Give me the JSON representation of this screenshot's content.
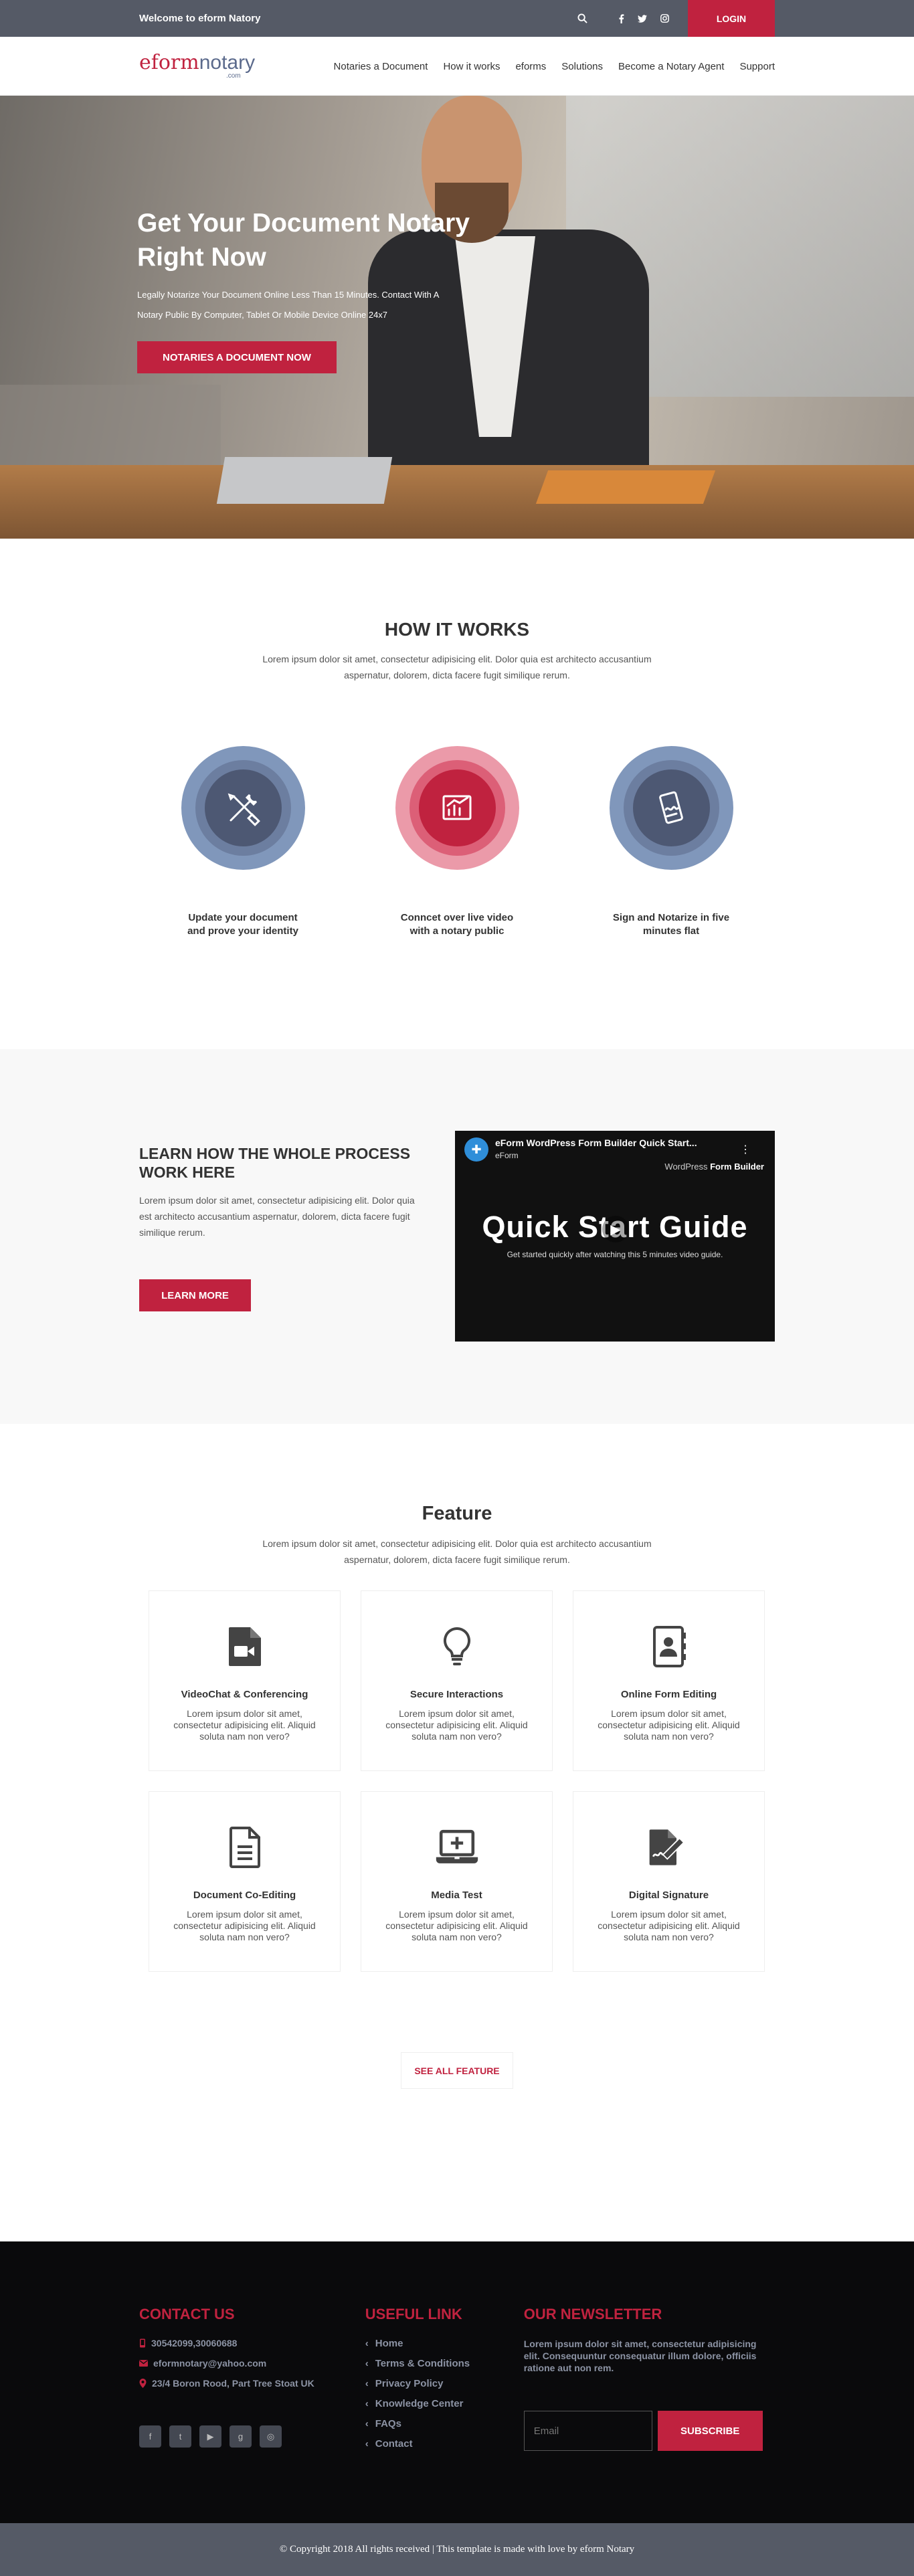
{
  "topbar": {
    "welcome": "Welcome to eform Natory",
    "login_label": "LOGIN",
    "icons": [
      "search-icon",
      "facebook-icon",
      "twitter-icon",
      "instagram-icon"
    ]
  },
  "logo": {
    "part1": "eform",
    "part2": "notary",
    "suffix": ".com"
  },
  "nav": {
    "items": [
      "Notaries a Document",
      "How it works",
      "eforms",
      "Solutions",
      "Become a Notary Agent",
      "Support"
    ]
  },
  "hero": {
    "title": "Get Your Document Notary Right Now",
    "subtitle": "Legally Notarize Your Document Online Less Than 15 Minutes. Contact With A Notary Public By Computer, Tablet Or Mobile Device Online 24x7",
    "button": "NOTARIES A DOCUMENT NOW"
  },
  "how": {
    "title": "HOW IT WORKS",
    "subtitle": "Lorem ipsum dolor sit amet, consectetur adipisicing elit. Dolor quia est architecto accusantium aspernatur, dolorem, dicta facere fugit similique rerum.",
    "steps": [
      {
        "label": "Update your document and prove your identity",
        "icon": "tools-icon",
        "color": "blue"
      },
      {
        "label": "Conncet over live video with a notary public",
        "icon": "video-chart-icon",
        "color": "red"
      },
      {
        "label": "Sign and Notarize in five minutes flat",
        "icon": "mobile-sign-icon",
        "color": "blue"
      }
    ]
  },
  "learn": {
    "title": "LEARN HOW THE WHOLE PROCESS WORK HERE",
    "text": "Lorem ipsum dolor sit amet, consectetur adipisicing elit. Dolor quia est architecto accusantium aspernatur, dolorem, dicta facere fugit similique rerum.",
    "button": "LEARN MORE",
    "video": {
      "title": "eForm WordPress Form Builder Quick Start...",
      "brand": "eForm",
      "right_text_1": "WordPress",
      "right_text_2": "Form Builder",
      "headline": "Quick Start Guide",
      "subline": "Get started quickly after watching this 5 minutes video guide."
    }
  },
  "feature": {
    "title": "Feature",
    "subtitle": "Lorem ipsum dolor sit amet, consectetur adipisicing elit. Dolor quia est architecto accusantium aspernatur, dolorem, dicta facere fugit similique rerum.",
    "cards": [
      {
        "title": "VideoChat & Conferencing",
        "text": "Lorem ipsum dolor sit amet, consectetur adipisicing elit. Aliquid soluta nam non vero?",
        "icon": "file-video-icon"
      },
      {
        "title": "Secure Interactions",
        "text": "Lorem ipsum dolor sit amet, consectetur adipisicing elit. Aliquid soluta nam non vero?",
        "icon": "lightbulb-icon"
      },
      {
        "title": "Online Form Editing",
        "text": "Lorem ipsum dolor sit amet, consectetur adipisicing elit. Aliquid soluta nam non vero?",
        "icon": "address-book-icon"
      },
      {
        "title": "Document Co-Editing",
        "text": "Lorem ipsum dolor sit amet, consectetur adipisicing elit. Aliquid soluta nam non vero?",
        "icon": "document-icon"
      },
      {
        "title": "Media Test",
        "text": "Lorem ipsum dolor sit amet, consectetur adipisicing elit. Aliquid soluta nam non vero?",
        "icon": "laptop-plus-icon"
      },
      {
        "title": "Digital Signature",
        "text": "Lorem ipsum dolor sit amet, consectetur adipisicing elit. Aliquid soluta nam non vero?",
        "icon": "file-signature-icon"
      }
    ],
    "see_all": "SEE ALL FEATURE"
  },
  "footer": {
    "contact": {
      "title": "CONTACT US",
      "phone": "30542099,30060688",
      "email": "eformnotary@yahoo.com",
      "address": "23/4 Boron Rood, Part Tree Stoat UK"
    },
    "links": {
      "title": "USEFUL LINK",
      "items": [
        "Home",
        "Terms & Conditions",
        "Privacy Policy",
        "Knowledge Center",
        "FAQs",
        "Contact"
      ]
    },
    "newsletter": {
      "title": "OUR NEWSLETTER",
      "text": "Lorem ipsum dolor sit amet, consectetur adipisicing elit. Consequuntur consequatur illum dolore, officiis ratione aut non rem.",
      "placeholder": "Email",
      "button": "SUBSCRIBE"
    },
    "socials": [
      "facebook-icon",
      "twitter-icon",
      "youtube-icon",
      "google-plus-icon",
      "instagram-icon"
    ],
    "copyright": "© Copyright 2018 All rights received | This template is made with love by eform Notary"
  },
  "colors": {
    "brand_red": "#c0223f",
    "slate": "#555a66",
    "steel_blue": "#8097bb"
  }
}
